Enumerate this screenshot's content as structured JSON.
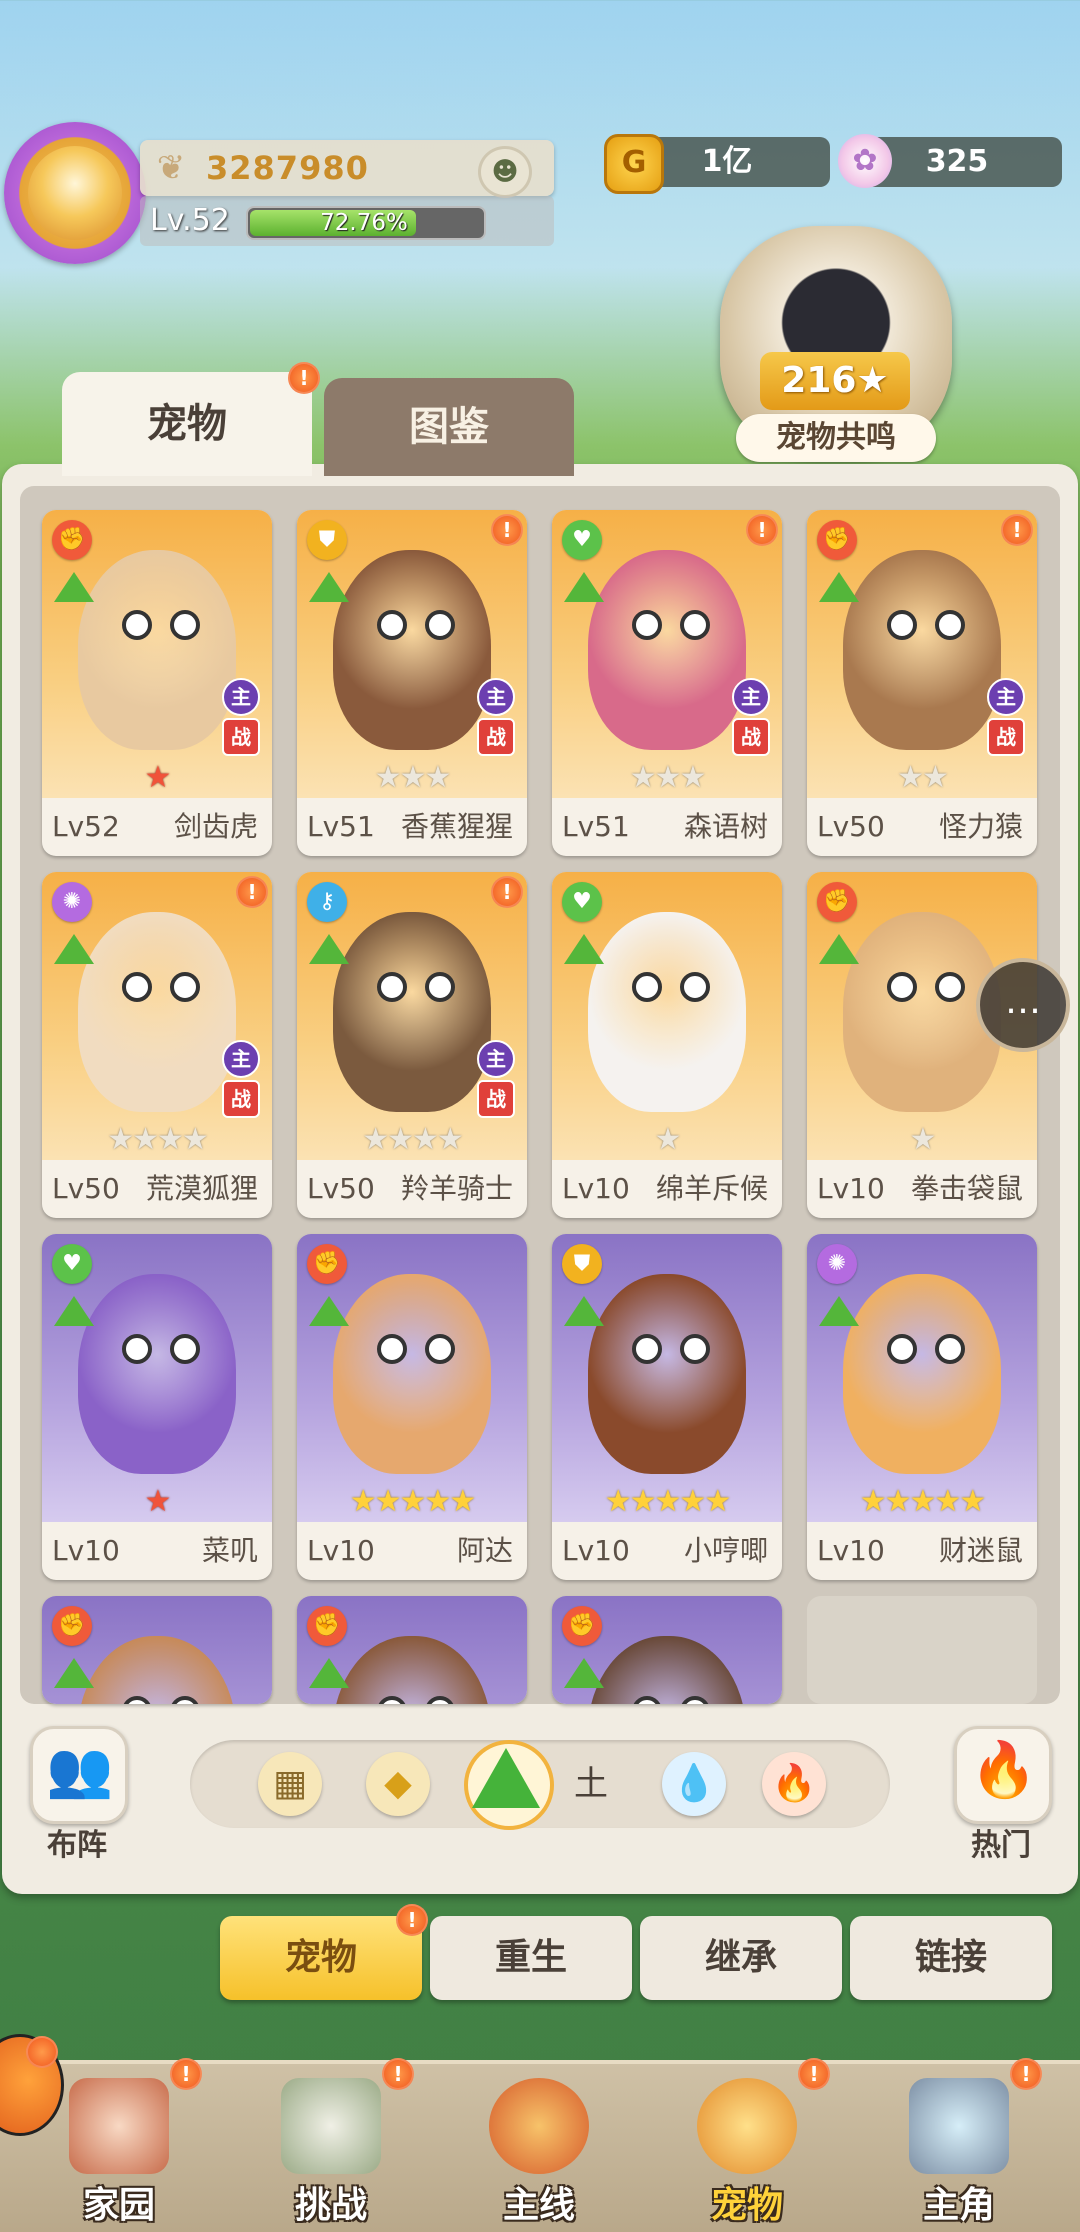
{
  "player": {
    "power": "3287980",
    "level": "Lv.52",
    "exp_percent": "72.76%",
    "exp_fraction": 0.7276
  },
  "currency": {
    "coins": "1亿",
    "coin_icon": "G",
    "gems": "325"
  },
  "resonance": {
    "count": "216★",
    "label": "宠物共鸣"
  },
  "tabs": [
    {
      "label": "宠物",
      "active": true,
      "badge": "!"
    },
    {
      "label": "图鉴",
      "active": false
    }
  ],
  "pets": [
    {
      "level": "Lv52",
      "name": "剑齿虎",
      "theme": "orange",
      "type": "fist",
      "stars": "★",
      "star_style": "red",
      "main": true,
      "badge": false,
      "color": "#e8c9a0"
    },
    {
      "level": "Lv51",
      "name": "香蕉猩猩",
      "theme": "orange",
      "type": "shield",
      "stars": "★★★",
      "star_style": "empty",
      "main": true,
      "badge": true,
      "color": "#8a5a3c"
    },
    {
      "level": "Lv51",
      "name": "森语树",
      "theme": "orange",
      "type": "heart",
      "stars": "★★★",
      "star_style": "empty",
      "main": true,
      "badge": true,
      "color": "#d86a8a"
    },
    {
      "level": "Lv50",
      "name": "怪力猿",
      "theme": "orange",
      "type": "fist",
      "stars": "★★",
      "star_style": "empty",
      "main": true,
      "badge": true,
      "color": "#a9794f"
    },
    {
      "level": "Lv50",
      "name": "荒漠狐狸",
      "theme": "orange",
      "type": "swirl",
      "stars": "★★★★",
      "star_style": "empty",
      "main": true,
      "badge": true,
      "color": "#f1dcc0"
    },
    {
      "level": "Lv50",
      "name": "羚羊骑士",
      "theme": "orange",
      "type": "key",
      "stars": "★★★★",
      "star_style": "empty",
      "main": true,
      "badge": true,
      "color": "#7b5a3e"
    },
    {
      "level": "Lv10",
      "name": "绵羊斥候",
      "theme": "orange",
      "type": "heart",
      "stars": "★",
      "star_style": "empty",
      "main": false,
      "badge": false,
      "color": "#f5f2ef"
    },
    {
      "level": "Lv10",
      "name": "拳击袋鼠",
      "theme": "orange",
      "type": "fist",
      "stars": "★",
      "star_style": "empty",
      "main": false,
      "badge": false,
      "color": "#e0b27c"
    },
    {
      "level": "Lv10",
      "name": "菜叽",
      "theme": "purple",
      "type": "heart",
      "stars": "★",
      "star_style": "red",
      "main": false,
      "badge": false,
      "color": "#8a62c8"
    },
    {
      "level": "Lv10",
      "name": "阿达",
      "theme": "purple",
      "type": "fist",
      "stars": "★★★★★",
      "star_style": "gold",
      "main": false,
      "badge": false,
      "color": "#e6a86e"
    },
    {
      "level": "Lv10",
      "name": "小哼唧",
      "theme": "purple",
      "type": "shield",
      "stars": "★★★★★",
      "star_style": "gold",
      "main": false,
      "badge": false,
      "color": "#8a4a2c"
    },
    {
      "level": "Lv10",
      "name": "财迷鼠",
      "theme": "purple",
      "type": "swirl",
      "stars": "★★★★★",
      "star_style": "gold",
      "main": false,
      "badge": false,
      "color": "#f0b060"
    }
  ],
  "partial_pets": [
    {
      "theme": "purple",
      "type": "fist",
      "color": "#c78a5a"
    },
    {
      "theme": "purple",
      "type": "fist",
      "color": "#8a5a3c"
    },
    {
      "theme": "purple",
      "type": "fist",
      "color": "#6a4a3a"
    }
  ],
  "tags": {
    "main": "主",
    "battle": "战"
  },
  "filters": {
    "formation_label": "布阵",
    "hot_label": "热门",
    "earth_label": "土"
  },
  "sub_tabs": [
    "宠物",
    "重生",
    "继承",
    "链接"
  ],
  "nav": [
    {
      "label": "家园",
      "badge": true
    },
    {
      "label": "挑战",
      "badge": true
    },
    {
      "label": "主线",
      "badge": false
    },
    {
      "label": "宠物",
      "badge": true
    },
    {
      "label": "主角",
      "badge": true
    }
  ],
  "colors": {
    "accent": "#f6c12a",
    "badge": "#f0571e",
    "earth": "#54b63a"
  }
}
